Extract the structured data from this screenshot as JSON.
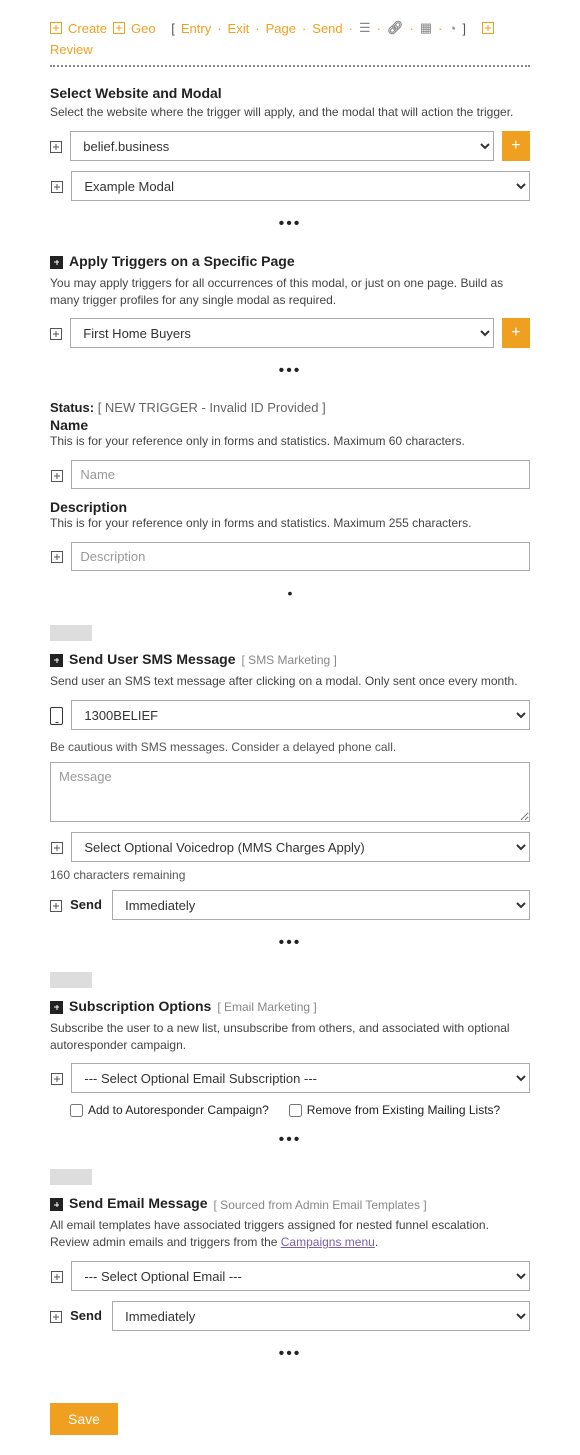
{
  "topnav": {
    "create": "Create",
    "geo": "Geo",
    "entry": "Entry",
    "exit": "Exit",
    "page": "Page",
    "send": "Send",
    "review": "Review"
  },
  "website_section": {
    "title": "Select Website and Modal",
    "desc": "Select the website where the trigger will apply, and the modal that will action the trigger.",
    "website_selected": "belief.business",
    "modal_selected": "Example Modal"
  },
  "page_section": {
    "title": "Apply Triggers on a Specific Page",
    "desc": "You may apply triggers for all occurrences of this modal, or just on one page. Build as many trigger profiles for any single modal as required.",
    "page_selected": "First Home Buyers"
  },
  "status": {
    "label": "Status:",
    "value": "[ NEW TRIGGER - Invalid ID Provided ]"
  },
  "name_section": {
    "title": "Name",
    "desc": "This is for your reference only in forms and statistics. Maximum 60 characters.",
    "placeholder": "Name"
  },
  "desc_section": {
    "title": "Description",
    "desc": "This is for your reference only in forms and statistics. Maximum 255 characters.",
    "placeholder": "Description"
  },
  "sms_section": {
    "title": "Send User SMS Message",
    "bracket": "[ SMS Marketing ]",
    "desc": "Send user an SMS text message after clicking on a modal. Only sent once every month.",
    "number_selected": "1300BELIEF",
    "hint": "Be cautious with SMS messages. Consider a delayed phone call.",
    "msg_placeholder": "Message",
    "voicedrop_selected": "Select Optional Voicedrop (MMS Charges Apply)",
    "remaining": "160 characters remaining",
    "send_label": "Send",
    "send_timing": "Immediately"
  },
  "sub_section": {
    "title": "Subscription Options",
    "bracket": "[ Email Marketing ]",
    "desc": "Subscribe the user to a new list, unsubscribe from others, and associated with optional autoresponder campaign.",
    "list_selected": "--- Select Optional Email Subscription ---",
    "chk1": "Add to Autoresponder Campaign?",
    "chk2": "Remove from Existing Mailing Lists?"
  },
  "email_section": {
    "title": "Send Email Message",
    "bracket": "[ Sourced from Admin Email Templates ]",
    "desc1": "All email templates have associated triggers assigned for nested funnel escalation. Review admin emails and triggers from the ",
    "link": "Campaigns menu",
    "desc2": ".",
    "email_selected": "--- Select Optional Email ---",
    "send_label": "Send",
    "send_timing": "Immediately"
  },
  "save_label": "Save"
}
